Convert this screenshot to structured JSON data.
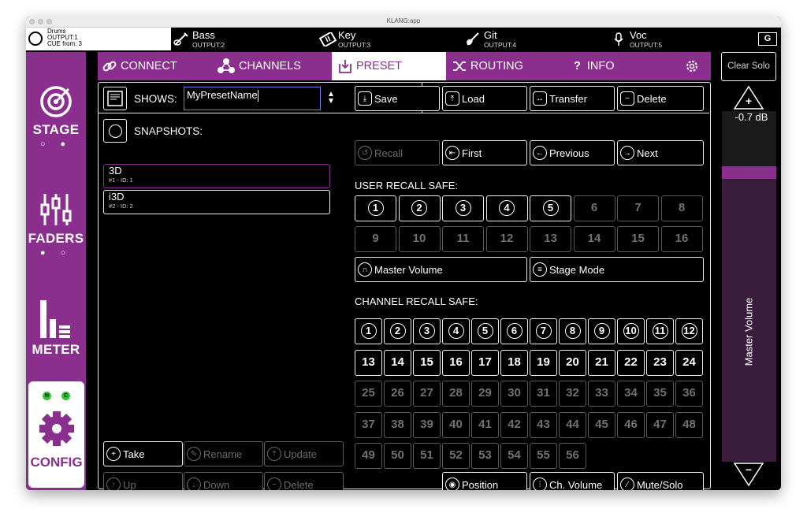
{
  "window": {
    "title": "KLANG:app"
  },
  "channels": [
    {
      "name": "Drums",
      "line2": "OUTPUT:1",
      "line3": "CUE from: 3"
    },
    {
      "name": "Bass",
      "output": "OUTPUT:2"
    },
    {
      "name": "Key",
      "output": "OUTPUT:3"
    },
    {
      "name": "Git",
      "output": "OUTPUT:4"
    },
    {
      "name": "Voc",
      "output": "OUTPUT:5"
    }
  ],
  "g_button": "G",
  "sidebar": {
    "stage": "STAGE",
    "faders": "FADERS",
    "meter": "METER",
    "config": "CONFIG",
    "n_badge": "N",
    "c_badge": "C",
    "stage_dots": "○ ●",
    "faders_dots": "● ○"
  },
  "tabs": {
    "connect": "CONNECT",
    "channels": "CHANNELS",
    "preset": "PRESET",
    "routing": "ROUTING",
    "info": "INFO"
  },
  "shows": {
    "label": "SHOWS:",
    "value": "MyPresetName"
  },
  "actions": {
    "save": "Save",
    "load": "Load",
    "transfer": "Transfer",
    "delete": "Delete"
  },
  "snapshots": {
    "label": "SNAPSHOTS:",
    "items": [
      {
        "name": "3D",
        "sub": "#1 - ID: 1"
      },
      {
        "name": "i3D",
        "sub": "#2 - ID: 2"
      }
    ]
  },
  "nav": {
    "recall": "Recall",
    "first": "First",
    "previous": "Previous",
    "next": "Next"
  },
  "user_recall": {
    "label": "USER RECALL SAFE:",
    "items": [
      "1",
      "2",
      "3",
      "4",
      "5",
      "6",
      "7",
      "8",
      "9",
      "10",
      "11",
      "12",
      "13",
      "14",
      "15",
      "16"
    ],
    "master_volume": "Master Volume",
    "stage_mode": "Stage Mode"
  },
  "channel_recall": {
    "label": "CHANNEL RECALL SAFE:",
    "items": [
      "1",
      "2",
      "3",
      "4",
      "5",
      "6",
      "7",
      "8",
      "9",
      "10",
      "11",
      "12",
      "13",
      "14",
      "15",
      "16",
      "17",
      "18",
      "19",
      "20",
      "21",
      "22",
      "23",
      "24",
      "25",
      "26",
      "27",
      "28",
      "29",
      "30",
      "31",
      "32",
      "33",
      "34",
      "35",
      "36",
      "37",
      "38",
      "39",
      "40",
      "41",
      "42",
      "43",
      "44",
      "45",
      "46",
      "47",
      "48",
      "49",
      "50",
      "51",
      "52",
      "53",
      "54",
      "55",
      "56"
    ]
  },
  "snap_actions": {
    "take": "Take",
    "rename": "Rename",
    "update": "Update",
    "up": "Up",
    "down": "Down",
    "delete": "Delete"
  },
  "bottom": {
    "position": "Position",
    "ch_volume": "Ch. Volume",
    "mute_solo": "Mute/Solo"
  },
  "right": {
    "clear_solo": "Clear Solo",
    "db": "-0.7 dB",
    "master_volume": "Master Volume",
    "plus": "+",
    "minus": "−"
  },
  "colors": {
    "accent": "#8a2f8e",
    "active_badge": "#39c23b",
    "input_border": "#6e78e8"
  }
}
